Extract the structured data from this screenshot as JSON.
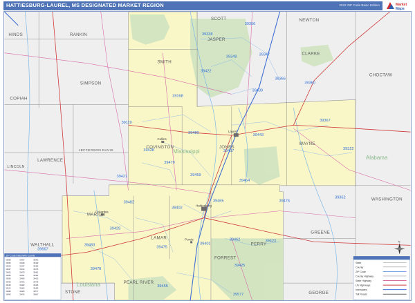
{
  "title": "HATTIESBURG-LAUREL, MS DESIGNATED MARKET REGION",
  "edition": "2022 ZIP Code Basic Edition",
  "logo": {
    "line1": "Market",
    "line2": "Maps"
  },
  "counties_in_region": [
    {
      "name": "JASPER"
    },
    {
      "name": "SMITH"
    },
    {
      "name": "COVINGTON"
    },
    {
      "name": "JONES"
    },
    {
      "name": "WAYNE"
    },
    {
      "name": "MARION"
    },
    {
      "name": "LAMAR"
    },
    {
      "name": "FORREST"
    },
    {
      "name": "PERRY"
    }
  ],
  "counties_outside": [
    {
      "name": "HINDS"
    },
    {
      "name": "RANKIN"
    },
    {
      "name": "SCOTT"
    },
    {
      "name": "NEWTON"
    },
    {
      "name": "CLARKE"
    },
    {
      "name": "CHOCTAW"
    },
    {
      "name": "SIMPSON"
    },
    {
      "name": "COPIAH"
    },
    {
      "name": "JEFFERSON DAVIS"
    },
    {
      "name": "LAWRENCE"
    },
    {
      "name": "LINCOLN"
    },
    {
      "name": "WALTHALL"
    },
    {
      "name": "PEARL RIVER"
    },
    {
      "name": "GREENE"
    },
    {
      "name": "WASHINGTON"
    },
    {
      "name": "GEORGE"
    },
    {
      "name": "STONE"
    }
  ],
  "state_labels": [
    {
      "name": "Mississippi"
    },
    {
      "name": "Alabama"
    },
    {
      "name": "Louisiana"
    }
  ],
  "zips": [
    {
      "code": "39338"
    },
    {
      "code": "39356"
    },
    {
      "code": "39348"
    },
    {
      "code": "39347"
    },
    {
      "code": "39422"
    },
    {
      "code": "39366"
    },
    {
      "code": "39360"
    },
    {
      "code": "39439"
    },
    {
      "code": "39168"
    },
    {
      "code": "39119"
    },
    {
      "code": "39480"
    },
    {
      "code": "39443"
    },
    {
      "code": "39367"
    },
    {
      "code": "39428"
    },
    {
      "code": "39437"
    },
    {
      "code": "39322"
    },
    {
      "code": "39479"
    },
    {
      "code": "39421"
    },
    {
      "code": "39459"
    },
    {
      "code": "39464"
    },
    {
      "code": "39482"
    },
    {
      "code": "39402"
    },
    {
      "code": "39465"
    },
    {
      "code": "39476"
    },
    {
      "code": "39362"
    },
    {
      "code": "39429"
    },
    {
      "code": "39483"
    },
    {
      "code": "39475"
    },
    {
      "code": "39401"
    },
    {
      "code": "39462"
    },
    {
      "code": "39423"
    },
    {
      "code": "39478"
    },
    {
      "code": "39425"
    },
    {
      "code": "39455"
    },
    {
      "code": "39577"
    },
    {
      "code": "39667"
    }
  ],
  "cities": [
    {
      "name": "Hattiesburg"
    },
    {
      "name": "Laurel"
    },
    {
      "name": "Collins"
    },
    {
      "name": "Columbia"
    },
    {
      "name": "Purvis"
    }
  ],
  "index_title": "ZIP Code Index/with Counts",
  "legend": {
    "rows": [
      "State",
      "County",
      "ZIP Code",
      "County Highway",
      "State Highway",
      "US Highways",
      "Interstates",
      "Toll Roads"
    ],
    "scale_title": "Scale"
  },
  "colors": {
    "region_fill": "#f9f6c8",
    "outside_fill": "#efefef",
    "forest_fill": "#cfe3c0",
    "header": "#4e73b6",
    "zip_text": "#2f6fd6",
    "water": "#7fb8e6",
    "interstate": "#3f6fd4",
    "us_highway": "#cf3a3a",
    "state_highway": "#d86aa8",
    "county_line": "#8c8c8c"
  },
  "icons": {
    "compass": "compass-rose-icon",
    "logo": "market-maps-logo-icon"
  }
}
